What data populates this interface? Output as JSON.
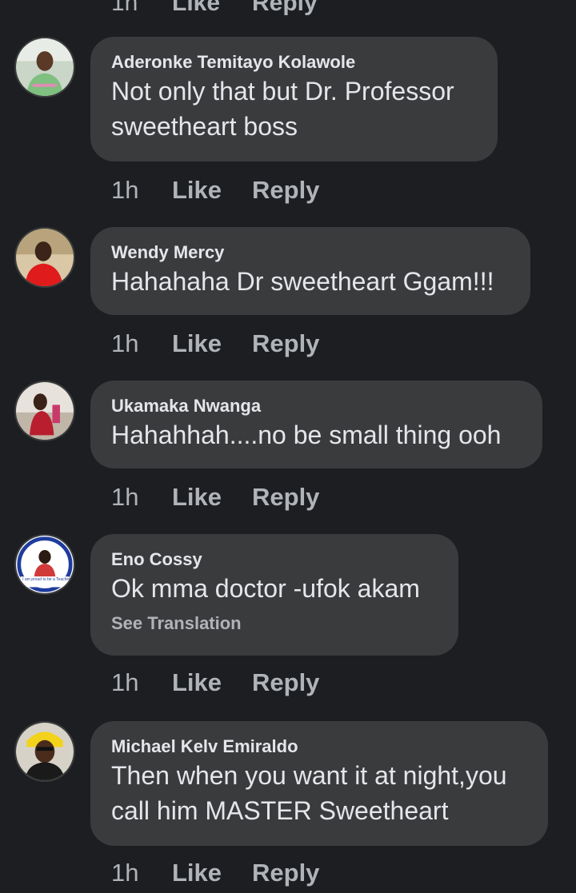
{
  "labels": {
    "like": "Like",
    "reply": "Reply",
    "top_time": "1h"
  },
  "comments": [
    {
      "author": "Aderonke Temitayo Kolawole",
      "text": "Not only that but Dr. Professor\nsweetheart boss",
      "time": "1h"
    },
    {
      "author": "Wendy Mercy",
      "text": "Hahahaha Dr sweetheart Ggam!!!",
      "time": "1h"
    },
    {
      "author": "Ukamaka Nwanga",
      "text": "Hahahhah....no be small thing ooh",
      "time": "1h"
    },
    {
      "author": "Eno Cossy",
      "text": "Ok mma doctor -ufok akam",
      "see_translation": "See Translation",
      "time": "1h",
      "avatar_text": "I am proud to be a Teacher"
    },
    {
      "author": "Michael Kelv Emiraldo",
      "text": "Then when you want it at night,you\ncall him MASTER Sweetheart",
      "time": "1h"
    }
  ],
  "colors": {
    "background": "#1c1e21",
    "bubble": "#3a3b3c",
    "primary_text": "#e4e6eb",
    "secondary_text": "#b0b3b8"
  }
}
